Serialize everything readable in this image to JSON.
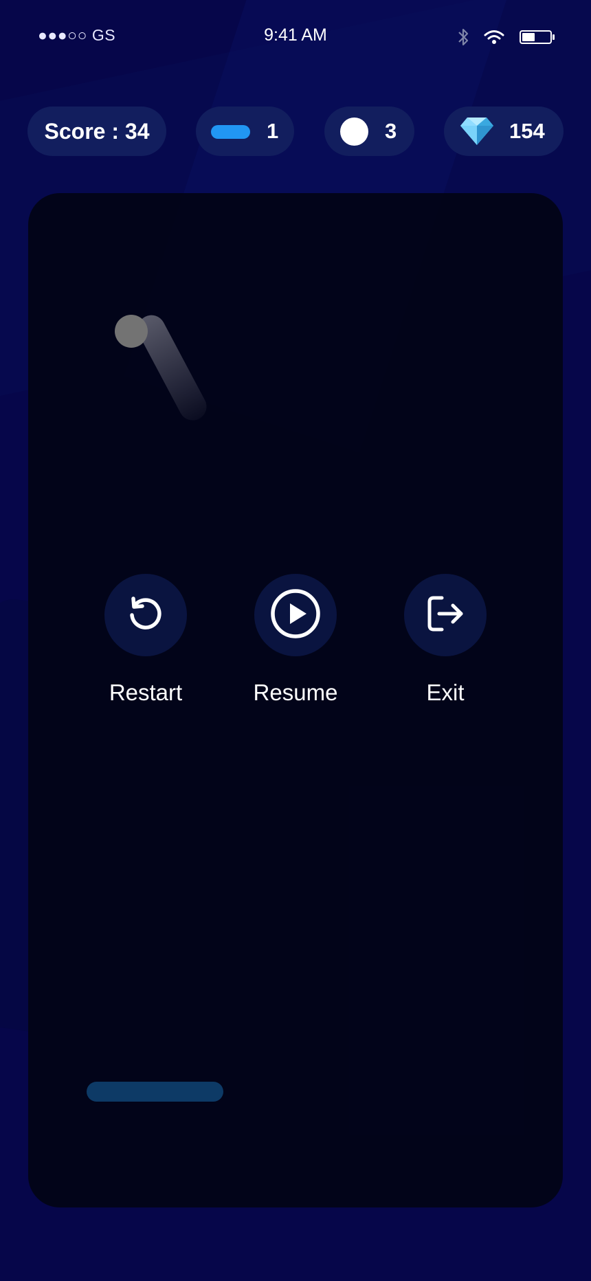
{
  "status_bar": {
    "carrier": "●●●○○ GS",
    "time": "9:41 AM",
    "battery_level": 0.45
  },
  "hud": {
    "score_text": "Score : 34",
    "paddle_count": "1",
    "ball_count": "3",
    "gem_count": "154",
    "paddle_color": "#2196f3",
    "gem_color": "#5bc8f5"
  },
  "pause_menu": {
    "restart_label": "Restart",
    "resume_label": "Resume",
    "exit_label": "Exit"
  },
  "colors": {
    "background": "#06064a",
    "board": "#020416",
    "pill": "#121e5e",
    "menu_button": "#0a1440",
    "game_paddle": "#0d3a66",
    "ball": "#737373"
  },
  "icons": [
    "bluetooth-icon",
    "wifi-icon",
    "battery-icon",
    "paddle-icon",
    "ball-icon",
    "gem-icon",
    "restart-icon",
    "resume-icon",
    "exit-icon"
  ]
}
